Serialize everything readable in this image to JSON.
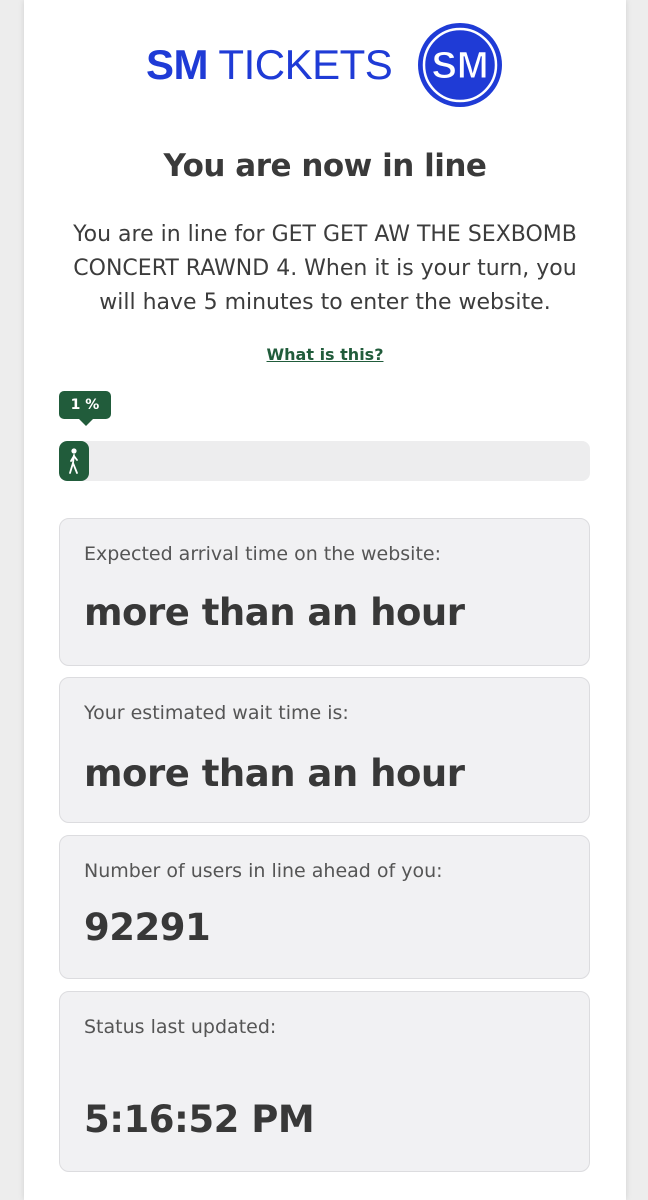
{
  "header": {
    "brand_sm": "SM",
    "brand_tickets": "TICKETS",
    "logo_text": "SM",
    "brand_color": "#1f3bd6"
  },
  "queue": {
    "title": "You are now in line",
    "description": "You are in line for GET GET AW THE SEXBOMB CONCERT RAWND 4. When it is your turn, you will have 5 minutes to enter the website.",
    "what_link": "What is this?",
    "progress_label": "1 %",
    "progress_percent": 1,
    "accent_color": "#215c3b"
  },
  "cards": {
    "arrival": {
      "label": "Expected arrival time on the website:",
      "value": "more than an hour"
    },
    "wait": {
      "label": "Your estimated wait time is:",
      "value": "more than an hour"
    },
    "ahead": {
      "label": "Number of users in line ahead of you:",
      "value": "92291"
    },
    "updated": {
      "label": "Status last updated:",
      "value": "5:16:52 PM"
    }
  },
  "icons": {
    "progress_icon": "walking-person-icon",
    "logo_icon": "sm-logo-icon"
  }
}
